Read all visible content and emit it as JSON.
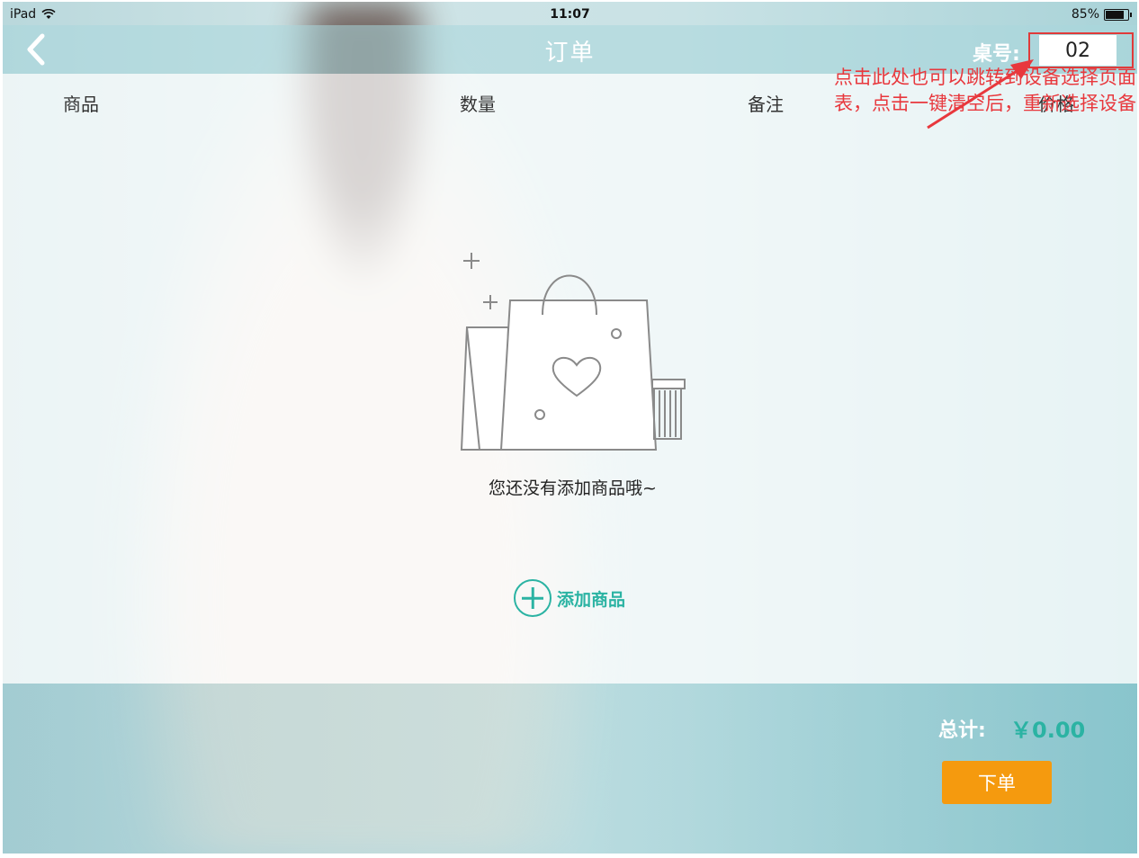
{
  "status_bar": {
    "device": "iPad",
    "time": "11:07",
    "battery_text": "85%",
    "battery_level": 0.85
  },
  "nav": {
    "title": "订单",
    "table_label": "桌号:",
    "table_value": "02"
  },
  "columns": [
    "商品",
    "数量",
    "备注",
    "价格"
  ],
  "annotation": {
    "line1": "点击此处也可以跳转到设备选择页面",
    "line2": "表，点击一键清空后，重新选择设备",
    "color": "#e8383d"
  },
  "empty_state": {
    "message": "您还没有添加商品哦~",
    "add_label": "添加商品"
  },
  "footer": {
    "total_label": "总计:",
    "total_value": "￥0.00",
    "order_button": "下单"
  },
  "colors": {
    "accent": "#2bb3a3",
    "order_button": "#f59a0e",
    "highlight_border": "#e03a3a"
  }
}
